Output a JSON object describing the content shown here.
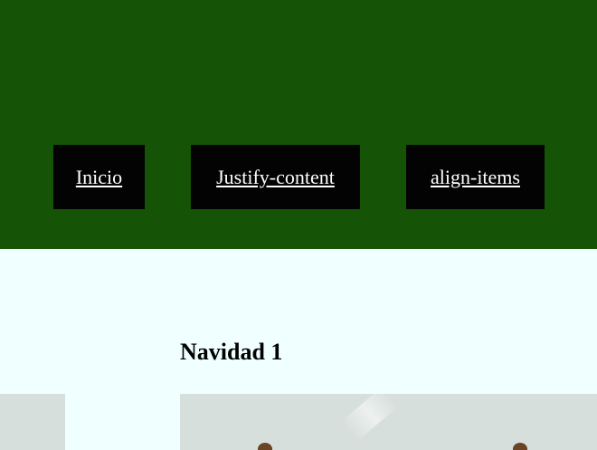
{
  "nav": {
    "items": [
      {
        "label": "Inicio"
      },
      {
        "label": "Justify-content"
      },
      {
        "label": "align-items"
      }
    ]
  },
  "content": {
    "heading": "Navidad 1"
  },
  "colors": {
    "header_bg": "#155306",
    "nav_bg": "#030303",
    "page_bg": "#f0ffff"
  }
}
